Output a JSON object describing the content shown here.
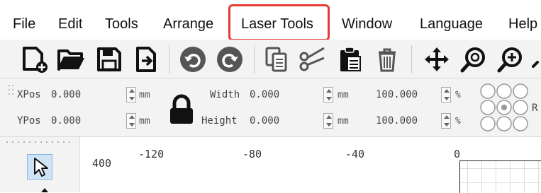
{
  "menu": {
    "items": [
      {
        "label": "File"
      },
      {
        "label": "Edit"
      },
      {
        "label": "Tools"
      },
      {
        "label": "Arrange"
      },
      {
        "label": "Laser Tools"
      },
      {
        "label": "Window"
      },
      {
        "label": "Language"
      },
      {
        "label": "Help"
      }
    ],
    "highlight_color": "#e53935"
  },
  "toolbar": {
    "icons": [
      "new-file-icon",
      "open-folder-icon",
      "save-icon",
      "import-icon",
      "undo-icon",
      "redo-icon",
      "copy-icon",
      "cut-icon",
      "paste-icon",
      "delete-icon",
      "move-icon",
      "zoom-fit-icon",
      "zoom-in-icon"
    ]
  },
  "properties": {
    "xpos_label": "XPos",
    "xpos_value": "0.000",
    "ypos_label": "YPos",
    "ypos_value": "0.000",
    "unit_mm": "mm",
    "width_label": "Width",
    "width_value": "0.000",
    "height_label": "Height",
    "height_value": "0.000",
    "width_pct": "100.000",
    "height_pct": "100.000",
    "unit_pct": "%",
    "trailing": "R"
  },
  "rulers": {
    "left_value": "400",
    "top_ticks": [
      "-120",
      "-80",
      "-40",
      "0"
    ]
  }
}
